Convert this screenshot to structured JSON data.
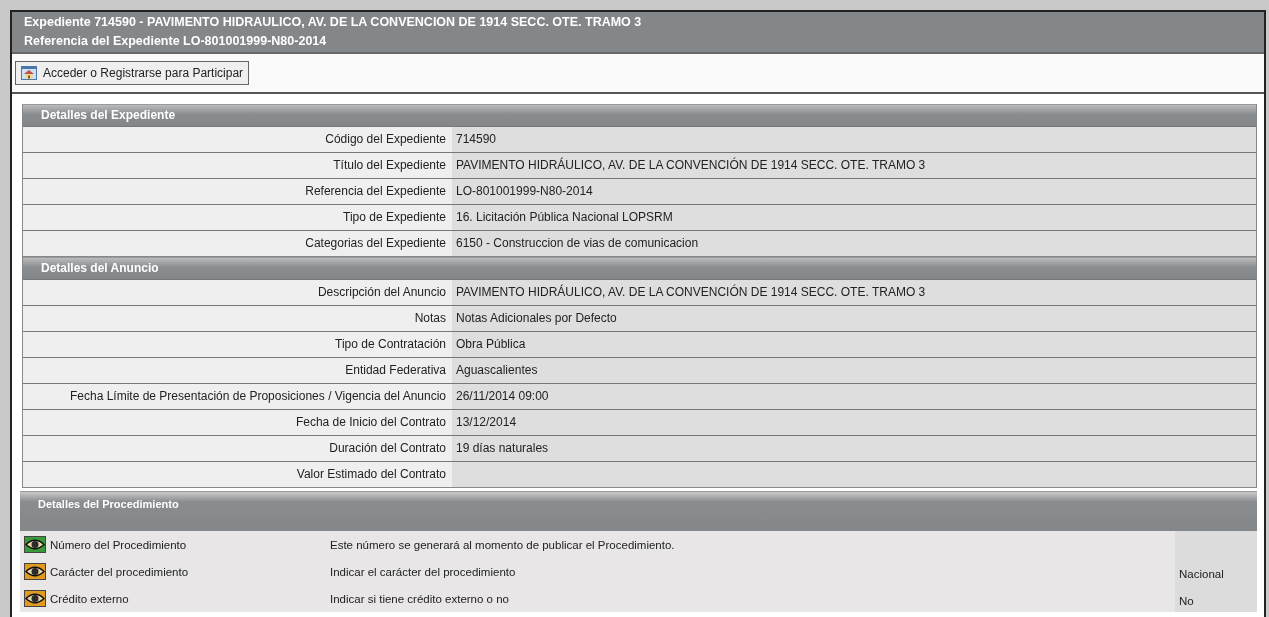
{
  "header": {
    "title": "Expediente 714590 - PAVIMENTO HIDRAULICO, AV. DE LA CONVENCION DE 1914 SECC. OTE. TRAMO 3",
    "subtitle": "Referencia del Expediente LO-801001999-N80-2014"
  },
  "toolbar": {
    "buttons": [
      {
        "label": "Acceder o Registrarse para Participar"
      }
    ]
  },
  "sections": [
    {
      "title": "Detalles del Expediente",
      "rows": [
        {
          "label": "Código del Expediente",
          "value": "714590"
        },
        {
          "label": "Título del Expediente",
          "value": "PAVIMENTO HIDRÁULICO, AV. DE LA CONVENCIÓN DE 1914 SECC. OTE. TRAMO 3"
        },
        {
          "label": "Referencia del Expediente",
          "value": "LO-801001999-N80-2014"
        },
        {
          "label": "Tipo de Expediente",
          "value": "16. Licitación Pública Nacional LOPSRM"
        },
        {
          "label": "Categorias del Expediente",
          "value": "6150 - Construccion de vias de comunicacion"
        }
      ]
    },
    {
      "title": "Detalles del Anuncio",
      "rows": [
        {
          "label": "Descripción del Anuncio",
          "value": "PAVIMENTO HIDRÁULICO, AV. DE LA CONVENCIÓN DE 1914 SECC. OTE. TRAMO 3"
        },
        {
          "label": "Notas",
          "value": "Notas Adicionales por Defecto"
        },
        {
          "label": "Tipo de Contratación",
          "value": "Obra Pública"
        },
        {
          "label": "Entidad Federativa",
          "value": "Aguascalientes"
        },
        {
          "label": "Fecha Límite de Presentación de Proposiciones / Vigencia del Anuncio",
          "value": "26/11/2014 09:00"
        },
        {
          "label": "Fecha de Inicio del Contrato",
          "value": "13/12/2014"
        },
        {
          "label": "Duración del Contrato",
          "value": "19 días naturales"
        },
        {
          "label": "Valor Estimado del Contrato"
        }
      ]
    }
  ],
  "procedure": {
    "title": "Detalles del Procedimiento",
    "rows": [
      {
        "name": "Número del Procedimiento",
        "description": "Este número se generará al momento de publicar el Procedimiento.",
        "color": "#3a9a3a"
      },
      {
        "name": "Carácter del procedimiento",
        "description": "Indicar el carácter del procedimiento",
        "value": "Nacional",
        "color": "#e09a1e"
      },
      {
        "name": "Crédito externo",
        "description": "Indicar si tiene crédito externo o no",
        "value": "No",
        "color": "#e09a1e"
      }
    ]
  }
}
